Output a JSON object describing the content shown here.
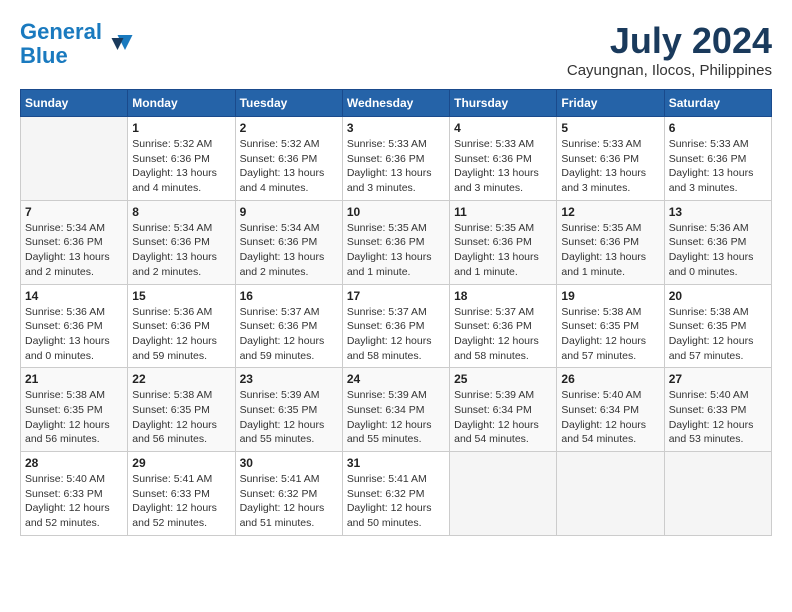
{
  "header": {
    "logo_line1": "General",
    "logo_line2": "Blue",
    "month_title": "July 2024",
    "location": "Cayungnan, Ilocos, Philippines"
  },
  "days_of_week": [
    "Sunday",
    "Monday",
    "Tuesday",
    "Wednesday",
    "Thursday",
    "Friday",
    "Saturday"
  ],
  "weeks": [
    [
      {
        "day": "",
        "info": ""
      },
      {
        "day": "1",
        "info": "Sunrise: 5:32 AM\nSunset: 6:36 PM\nDaylight: 13 hours\nand 4 minutes."
      },
      {
        "day": "2",
        "info": "Sunrise: 5:32 AM\nSunset: 6:36 PM\nDaylight: 13 hours\nand 4 minutes."
      },
      {
        "day": "3",
        "info": "Sunrise: 5:33 AM\nSunset: 6:36 PM\nDaylight: 13 hours\nand 3 minutes."
      },
      {
        "day": "4",
        "info": "Sunrise: 5:33 AM\nSunset: 6:36 PM\nDaylight: 13 hours\nand 3 minutes."
      },
      {
        "day": "5",
        "info": "Sunrise: 5:33 AM\nSunset: 6:36 PM\nDaylight: 13 hours\nand 3 minutes."
      },
      {
        "day": "6",
        "info": "Sunrise: 5:33 AM\nSunset: 6:36 PM\nDaylight: 13 hours\nand 3 minutes."
      }
    ],
    [
      {
        "day": "7",
        "info": "Sunrise: 5:34 AM\nSunset: 6:36 PM\nDaylight: 13 hours\nand 2 minutes."
      },
      {
        "day": "8",
        "info": "Sunrise: 5:34 AM\nSunset: 6:36 PM\nDaylight: 13 hours\nand 2 minutes."
      },
      {
        "day": "9",
        "info": "Sunrise: 5:34 AM\nSunset: 6:36 PM\nDaylight: 13 hours\nand 2 minutes."
      },
      {
        "day": "10",
        "info": "Sunrise: 5:35 AM\nSunset: 6:36 PM\nDaylight: 13 hours\nand 1 minute."
      },
      {
        "day": "11",
        "info": "Sunrise: 5:35 AM\nSunset: 6:36 PM\nDaylight: 13 hours\nand 1 minute."
      },
      {
        "day": "12",
        "info": "Sunrise: 5:35 AM\nSunset: 6:36 PM\nDaylight: 13 hours\nand 1 minute."
      },
      {
        "day": "13",
        "info": "Sunrise: 5:36 AM\nSunset: 6:36 PM\nDaylight: 13 hours\nand 0 minutes."
      }
    ],
    [
      {
        "day": "14",
        "info": "Sunrise: 5:36 AM\nSunset: 6:36 PM\nDaylight: 13 hours\nand 0 minutes."
      },
      {
        "day": "15",
        "info": "Sunrise: 5:36 AM\nSunset: 6:36 PM\nDaylight: 12 hours\nand 59 minutes."
      },
      {
        "day": "16",
        "info": "Sunrise: 5:37 AM\nSunset: 6:36 PM\nDaylight: 12 hours\nand 59 minutes."
      },
      {
        "day": "17",
        "info": "Sunrise: 5:37 AM\nSunset: 6:36 PM\nDaylight: 12 hours\nand 58 minutes."
      },
      {
        "day": "18",
        "info": "Sunrise: 5:37 AM\nSunset: 6:36 PM\nDaylight: 12 hours\nand 58 minutes."
      },
      {
        "day": "19",
        "info": "Sunrise: 5:38 AM\nSunset: 6:35 PM\nDaylight: 12 hours\nand 57 minutes."
      },
      {
        "day": "20",
        "info": "Sunrise: 5:38 AM\nSunset: 6:35 PM\nDaylight: 12 hours\nand 57 minutes."
      }
    ],
    [
      {
        "day": "21",
        "info": "Sunrise: 5:38 AM\nSunset: 6:35 PM\nDaylight: 12 hours\nand 56 minutes."
      },
      {
        "day": "22",
        "info": "Sunrise: 5:38 AM\nSunset: 6:35 PM\nDaylight: 12 hours\nand 56 minutes."
      },
      {
        "day": "23",
        "info": "Sunrise: 5:39 AM\nSunset: 6:35 PM\nDaylight: 12 hours\nand 55 minutes."
      },
      {
        "day": "24",
        "info": "Sunrise: 5:39 AM\nSunset: 6:34 PM\nDaylight: 12 hours\nand 55 minutes."
      },
      {
        "day": "25",
        "info": "Sunrise: 5:39 AM\nSunset: 6:34 PM\nDaylight: 12 hours\nand 54 minutes."
      },
      {
        "day": "26",
        "info": "Sunrise: 5:40 AM\nSunset: 6:34 PM\nDaylight: 12 hours\nand 54 minutes."
      },
      {
        "day": "27",
        "info": "Sunrise: 5:40 AM\nSunset: 6:33 PM\nDaylight: 12 hours\nand 53 minutes."
      }
    ],
    [
      {
        "day": "28",
        "info": "Sunrise: 5:40 AM\nSunset: 6:33 PM\nDaylight: 12 hours\nand 52 minutes."
      },
      {
        "day": "29",
        "info": "Sunrise: 5:41 AM\nSunset: 6:33 PM\nDaylight: 12 hours\nand 52 minutes."
      },
      {
        "day": "30",
        "info": "Sunrise: 5:41 AM\nSunset: 6:32 PM\nDaylight: 12 hours\nand 51 minutes."
      },
      {
        "day": "31",
        "info": "Sunrise: 5:41 AM\nSunset: 6:32 PM\nDaylight: 12 hours\nand 50 minutes."
      },
      {
        "day": "",
        "info": ""
      },
      {
        "day": "",
        "info": ""
      },
      {
        "day": "",
        "info": ""
      }
    ]
  ]
}
